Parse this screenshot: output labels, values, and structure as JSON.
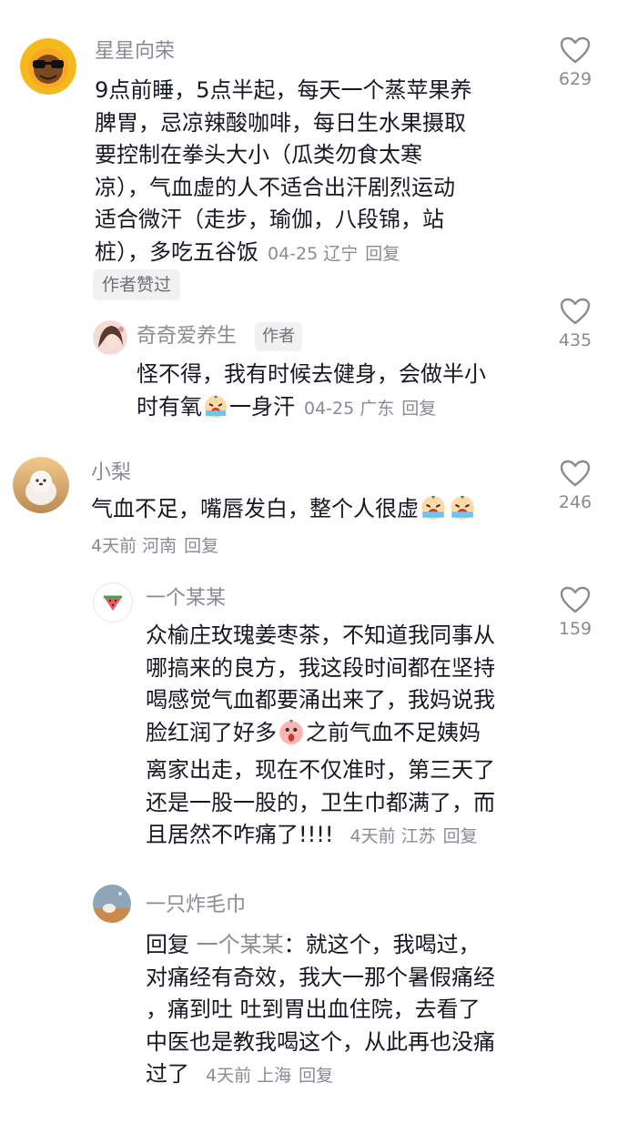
{
  "comments": [
    {
      "username": "星星向荣",
      "text": "9点前睡，5点半起，每天一个蒸苹果养脾胃，忌凉辣酸咖啡，每日生水果摄取要控制在拳头大小（瓜类勿食太寒凉），气血虚的人不适合出汗剧烈运动适合微汗（走步，瑜伽，八段锦，站桩），多吃五谷饭",
      "lines": [
        "9点前睡，5点半起，每天一个蒸苹果养",
        "脾胃，忌凉辣酸咖啡，每日生水果摄取",
        "要控制在拳头大小（瓜类勿食太寒",
        "凉），气血虚的人不适合出汗剧烈运动",
        "适合微汗（走步，瑜伽，八段锦，站",
        "桩），多吃五谷饭"
      ],
      "date": "04-25",
      "location": "辽宁",
      "reply_label": "回复",
      "liked_badge": "作者赞过",
      "likes": "629"
    },
    {
      "username": "奇奇爱养生",
      "author_tag": "作者",
      "lines": [
        "怪不得，我有时候去健身，会做半小",
        "时有氧",
        "一身汗"
      ],
      "date": "04-25",
      "location": "广东",
      "reply_label": "回复",
      "likes": "435"
    },
    {
      "username": "小梨",
      "lines": [
        "气血不足，嘴唇发白，整个人很虚"
      ],
      "date": "4天前",
      "location": "河南",
      "reply_label": "回复",
      "likes": "246"
    },
    {
      "username": "一个某某",
      "lines": [
        "众榆庄玫瑰姜枣茶，不知道我同事从",
        "哪搞来的良方，我这段时间都在坚持",
        "喝感觉气血都要涌出来了，我妈说我",
        "脸红润了好多",
        "之前气血不足姨妈",
        "离家出走，现在不仅准时，第三天了",
        "还是一股一股的，卫生巾都满了，而",
        "且居然不咋痛了!!!!"
      ],
      "date": "4天前",
      "location": "江苏",
      "reply_label": "回复",
      "likes": "159"
    },
    {
      "username": "一只炸毛巾",
      "reply_prefix": "回复 ",
      "reply_to": "一个某某",
      "lines": [
        "：就这个，我喝过，",
        "对痛经有奇效，我大一那个暑假痛经",
        "，痛到吐 吐到胃出血住院，去看了",
        "中医也是教我喝这个，从此再也没痛",
        "过了"
      ],
      "date": "4天前",
      "location": "上海",
      "reply_label": "回复"
    }
  ],
  "icons": {
    "like": "heart-outline-icon",
    "emoji_cry": "crying-face-emoji",
    "emoji_shock": "shocked-face-emoji"
  },
  "colors": {
    "text": "#161823",
    "secondary": "#8a8b91",
    "badge_bg": "#f1f1f2"
  }
}
